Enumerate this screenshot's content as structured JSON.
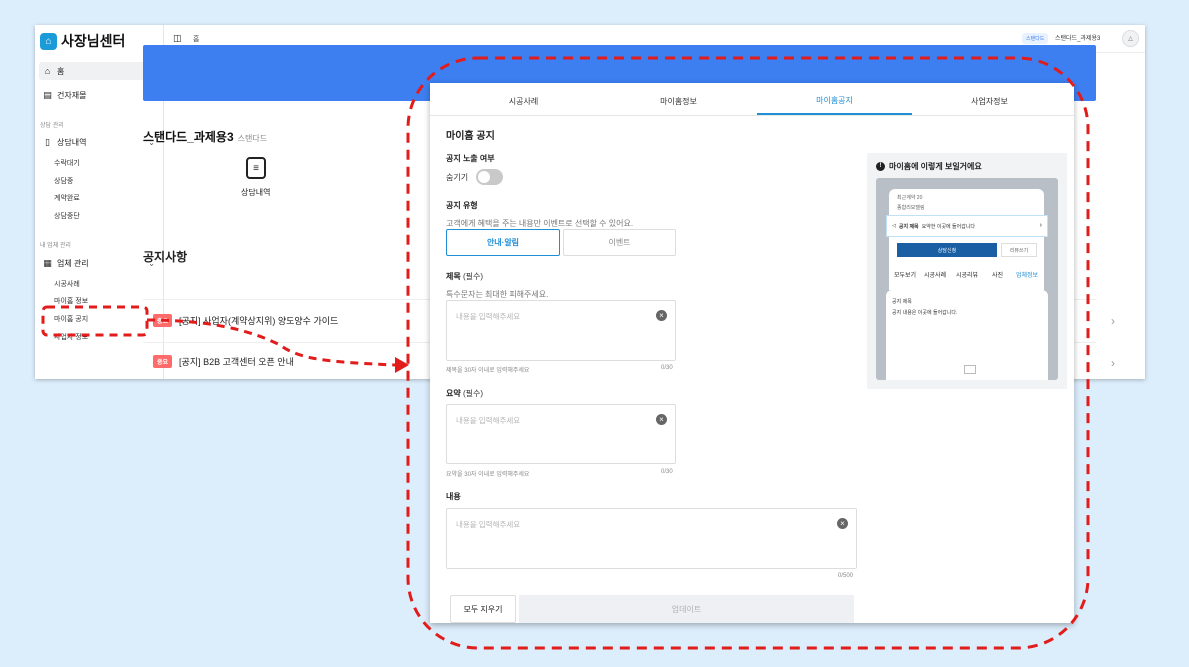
{
  "dashboard": {
    "brand": "사장님센터",
    "sidebar": {
      "home": "홈",
      "materials": "건자재몰",
      "group_consult": "상담 관리",
      "consult_history": "상담내역",
      "consult_items": [
        "수락대기",
        "상담중",
        "계약완료",
        "상담중단"
      ],
      "group_business": "내 업체 관리",
      "business_manage": "업체 관리",
      "business_items": [
        "시공사례",
        "마이홈 정보",
        "마이홈 공지",
        "사업자 정보"
      ]
    },
    "topbar": {
      "breadcrumb": "홈",
      "badge": "스탠다드",
      "user": "스탠다드_과제용3"
    },
    "shop": {
      "name": "스탠다드_과제용3",
      "tier": "스탠다드",
      "quick_action": "상담내역"
    },
    "notices": {
      "heading": "공지사항",
      "rows": [
        {
          "badge": "중요",
          "text": "[공지] 사업자(계약상지위) 양도양수 가이드"
        },
        {
          "badge": "중요",
          "text": "[공지] B2B 고객센터 오픈 안내"
        }
      ]
    }
  },
  "panel": {
    "tabs": [
      "시공사례",
      "마이홈정보",
      "마이홈공지",
      "사업자정보"
    ],
    "active_tab": 2,
    "title": "마이홈 공지",
    "visibility": {
      "label": "공지 노출 여부",
      "toggle_label": "숨기기",
      "enabled": false
    },
    "type": {
      "label": "공지 유형",
      "hint": "고객에게 혜택을 주는 내용만 이벤트로 선택할 수 있어요.",
      "options": [
        "안내·알림",
        "이벤트"
      ],
      "selected": 0
    },
    "title_field": {
      "label": "제목",
      "req": "(필수)",
      "hint": "특수문자는 최대한 피해주세요.",
      "placeholder": "내용을 입력해주세요",
      "helper": "제목을 30자 이내로 입력해주세요",
      "count": "0/30"
    },
    "summary_field": {
      "label": "요약",
      "req": "(필수)",
      "placeholder": "내용을 입력해주세요",
      "helper": "요약을 30자 이내로 입력해주세요",
      "count": "0/30"
    },
    "content_field": {
      "label": "내용",
      "placeholder": "내용을 입력해주세요",
      "count": "0/500"
    },
    "buttons": {
      "clear": "모두 지우기",
      "update": "업데이트"
    },
    "preview": {
      "title": "마이홈에 이렇게 보일거에요",
      "line1": "최근계약 20",
      "line2": "종합리모델링",
      "notice_title": "공지 제목",
      "notice_summary": "요약한 이곳에 들어갑니다",
      "btn_consult": "상담신청",
      "btn_review": "리뷰쓰기",
      "tabs": [
        "모두보기",
        "시공사례",
        "시공리뷰",
        "사진",
        "업체정보"
      ],
      "card_title": "공지 제목",
      "card_body": "공지 내용은 이곳에 들어갑니다."
    }
  },
  "colors": {
    "page_bg": "#dcedfb",
    "accent": "#1f8fd6",
    "banner": "#3d7ef1",
    "annotation": "#e21b1b"
  }
}
